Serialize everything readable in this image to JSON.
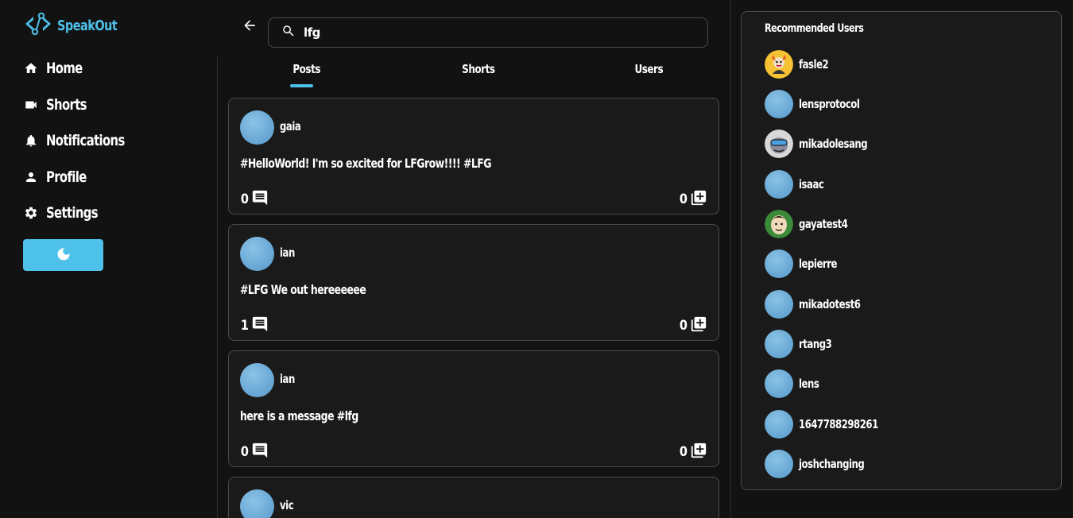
{
  "app": {
    "name": "SpeakOut"
  },
  "nav": {
    "items": [
      {
        "label": "Home",
        "icon": "home-icon"
      },
      {
        "label": "Shorts",
        "icon": "video-camera-icon"
      },
      {
        "label": "Notifications",
        "icon": "bell-icon"
      },
      {
        "label": "Profile",
        "icon": "person-icon"
      },
      {
        "label": "Settings",
        "icon": "gear-icon"
      }
    ],
    "theme_toggle_icon": "moon-icon"
  },
  "search": {
    "value": "lfg"
  },
  "tabs": [
    {
      "label": "Posts",
      "active": true
    },
    {
      "label": "Shorts",
      "active": false
    },
    {
      "label": "Users",
      "active": false
    }
  ],
  "posts": [
    {
      "user": "gaia",
      "text": "#HelloWorld! I'm so excited for LFGrow!!!! #LFG",
      "comments": "0",
      "collects": "0"
    },
    {
      "user": "ian",
      "text": "#LFG We out hereeeeee",
      "comments": "1",
      "collects": "0"
    },
    {
      "user": "ian",
      "text": "here is a message #lfg",
      "comments": "0",
      "collects": "0"
    },
    {
      "user": "vic",
      "text": "",
      "comments": "",
      "collects": ""
    }
  ],
  "recommended": {
    "title": "Recommended Users",
    "users": [
      {
        "name": "fasle2",
        "avatar": "cartoon-fox"
      },
      {
        "name": "lensprotocol",
        "avatar": "default"
      },
      {
        "name": "mikadolesang",
        "avatar": "cartoon-goggles"
      },
      {
        "name": "isaac",
        "avatar": "default"
      },
      {
        "name": "gayatest4",
        "avatar": "cartoon-face"
      },
      {
        "name": "lepierre",
        "avatar": "default"
      },
      {
        "name": "mikadotest6",
        "avatar": "default"
      },
      {
        "name": "rtang3",
        "avatar": "default"
      },
      {
        "name": "lens",
        "avatar": "default"
      },
      {
        "name": "1647788298261",
        "avatar": "default"
      },
      {
        "name": "joshchanging",
        "avatar": "default"
      }
    ]
  },
  "colors": {
    "accent": "#4ec1ea",
    "background": "#121212",
    "card": "#1a1a1a",
    "border": "#4a4a4a"
  }
}
